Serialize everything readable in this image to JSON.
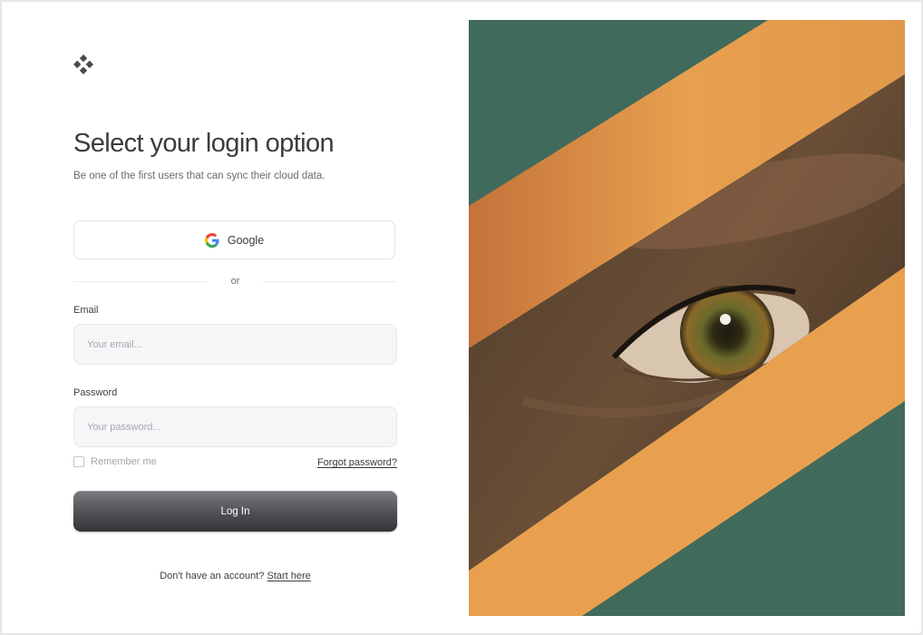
{
  "brand": {
    "logo_icon": "four-diamond-logo-icon"
  },
  "heading": {
    "title": "Select your login option",
    "subtitle": "Be one of the first users that can sync their cloud data."
  },
  "oauth": {
    "google_label": "Google",
    "google_icon": "google-g-icon"
  },
  "divider": {
    "label": "or"
  },
  "form": {
    "email_label": "Email",
    "email_placeholder": "Your email...",
    "email_value": "",
    "password_label": "Password",
    "password_placeholder": "Your password...",
    "password_value": "",
    "remember_label": "Remember me",
    "remember_checked": false,
    "forgot_label": "Forgot password?",
    "login_label": "Log In"
  },
  "footer": {
    "prompt": "Don't have an account?",
    "link_label": "Start here"
  },
  "hero": {
    "image": "eye-through-diagonal-orange-stripe",
    "colors": {
      "teal": "#3f6a5c",
      "orange": "#e8a04f",
      "iris": "#6a6a2c"
    }
  },
  "colors": {
    "accent_button": "#4f4f55",
    "text_primary": "#3a3a3e",
    "text_muted": "#6b6b70",
    "input_bg": "#f6f6f9"
  }
}
